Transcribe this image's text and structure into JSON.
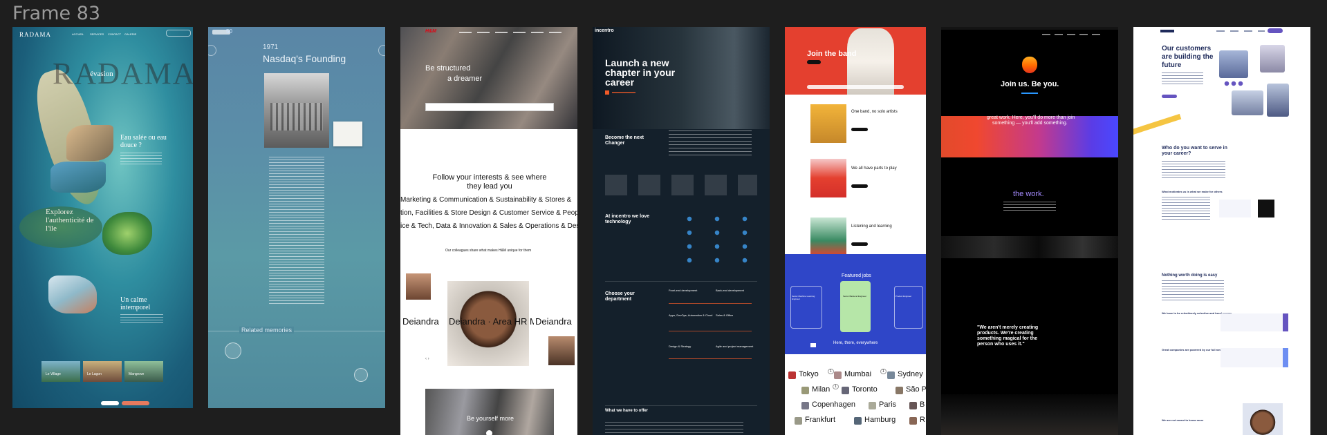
{
  "canvas": {
    "frame_label": "Frame 83"
  },
  "cards": {
    "radama": {
      "logo": "RADAMA",
      "nav": [
        "ACCUEIL",
        "SERVICES",
        "CONTACT",
        "GALERIE"
      ],
      "hero_word": "RADAMA",
      "hero_sub": "évasion",
      "s1_title": "Eau salée ou eau douce ?",
      "s2_title": "Explorez l'authenticité de l'île",
      "s3_title": "Un calme intemporel",
      "thumbs": [
        "Le Village",
        "Le Lagon",
        "Mangrove"
      ]
    },
    "nasdaq": {
      "year": "1971",
      "title": "Nasdaq's Founding",
      "related": "Related memories"
    },
    "hm": {
      "logo": "H&M",
      "hero_line1": "Be structured",
      "hero_line2": "a dreamer",
      "follow_title": "Follow your interests & see where they lead you",
      "marquee1": "Marketing & Communication & Sustainability & Stores & ",
      "marquee2": "tion, Facilities & Store Design & Customer Service & People",
      "marquee3": "ice & Tech, Data & Innovation & Sales & Operations & Desi",
      "colleague_title": "Our colleagues share what makes H&M unique for them",
      "name_left": "Deiandra",
      "role": "Deiandra · Area HR Manager",
      "name_right": "Deiandra",
      "bottom_caption": "Be yourself more"
    },
    "incentro": {
      "logo": "incentro",
      "hero": [
        "Launch a new",
        "chapter in your",
        "career"
      ],
      "section1": [
        "Become the next",
        "Changer"
      ],
      "section2": [
        "At incentro we love",
        "technology"
      ],
      "section3": [
        "Choose your",
        "department"
      ],
      "dept_col1": [
        "Front-end development",
        "Apps, DevOps, Automation & Cloud",
        "Design & Strategy"
      ],
      "dept_col2": [
        "Back-end development",
        "Sales & Office",
        "Agile and project management"
      ],
      "offer_title": "What we have to offer"
    },
    "spotify": {
      "hero": "Join the band",
      "row1": "One band, no solo artists",
      "row2": "We all have parts to play",
      "row3": "Listening and learning",
      "featured": "Featured jobs",
      "jobs": [
        "Senior Machine Learning Engineer",
        "Senior Backend Engineer",
        "Product Engineer"
      ],
      "here": "Here, there, everywhere",
      "cities_row1": [
        "Tokyo",
        "Mumbai",
        "Sydney"
      ],
      "cities_row2": [
        "Milan",
        "Toronto",
        "São P"
      ],
      "cities_row3": [
        "Copenhagen",
        "Paris",
        "B"
      ],
      "cities_row4": [
        "Frankfurt",
        "Hamburg",
        "R"
      ],
      "city_counts": [
        "1",
        "1",
        "1"
      ]
    },
    "apple": {
      "logo_glyph": "",
      "hero": "Join us. Be you.",
      "band_text": [
        "great work. Here, you'll do more than join",
        "something — you'll add something."
      ],
      "the_work": "the work.",
      "quote": [
        "\"We aren't merely creating",
        "products. We're creating",
        "something magical for the",
        "person who uses it.\""
      ]
    },
    "atlassian": {
      "hero": [
        "Our customers",
        "are building the",
        "future"
      ],
      "section1": [
        "Who do you want to serve in",
        "your career?"
      ],
      "section2": "What motivates us is what we make for others",
      "section3": "Nothing worth doing is easy",
      "section4": "We have to be relentlessly selective and break norms",
      "section5": "Great companies are powered by our full range",
      "section6": "We are not meant to know more"
    }
  },
  "colors": {
    "canvas_bg": "#1e1e1e",
    "radama_sea": "#2f8ea0",
    "nasdaq_blue": "#5b8ea8",
    "hm_red": "#e50010",
    "incentro_bg": "#14202b",
    "incentro_orange": "#f05a28",
    "spotify_red": "#e4402f",
    "spotify_blue": "#2f46c8",
    "apple_bg": "#000000",
    "atlassian_blue": "#1e2a5a",
    "atlassian_purple": "#6554c0"
  }
}
